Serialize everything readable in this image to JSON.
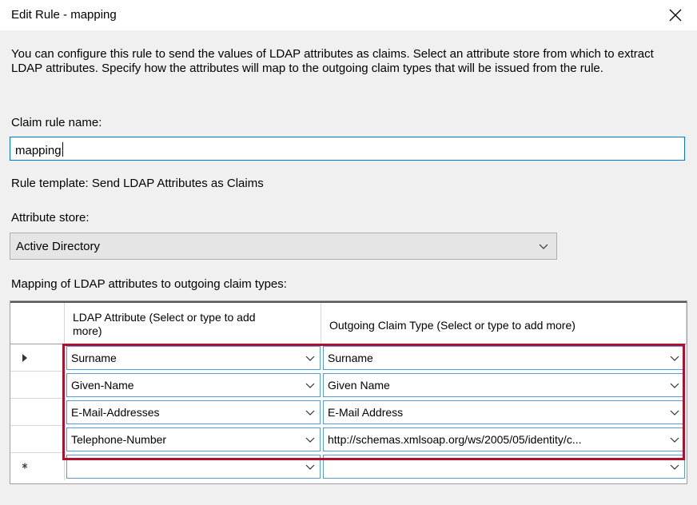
{
  "window": {
    "title": "Edit Rule - mapping"
  },
  "description": "You can configure this rule to send the values of LDAP attributes as claims. Select an attribute store from which to extract LDAP attributes. Specify how the attributes will map to the outgoing claim types that will be issued from the rule.",
  "claim_rule_name": {
    "label": "Claim rule name:",
    "value": "mapping"
  },
  "rule_template": "Rule template: Send LDAP Attributes as Claims",
  "attribute_store": {
    "label": "Attribute store:",
    "value": "Active Directory"
  },
  "mapping": {
    "label": "Mapping of LDAP attributes to outgoing claim types:",
    "columns": [
      "LDAP Attribute (Select or type to add more)",
      "Outgoing Claim Type (Select or type to add more)"
    ],
    "rows": [
      {
        "ldap": "Surname",
        "claim": "Surname"
      },
      {
        "ldap": "Given-Name",
        "claim": "Given Name"
      },
      {
        "ldap": "E-Mail-Addresses",
        "claim": "E-Mail Address"
      },
      {
        "ldap": "Telephone-Number",
        "claim": "http://schemas.xmlsoap.org/ws/2005/05/identity/c..."
      },
      {
        "ldap": "",
        "claim": ""
      }
    ]
  },
  "colors": {
    "highlight": "#b0102b",
    "focus_border": "#0078d7",
    "cell_border": "#5b9bd5"
  }
}
